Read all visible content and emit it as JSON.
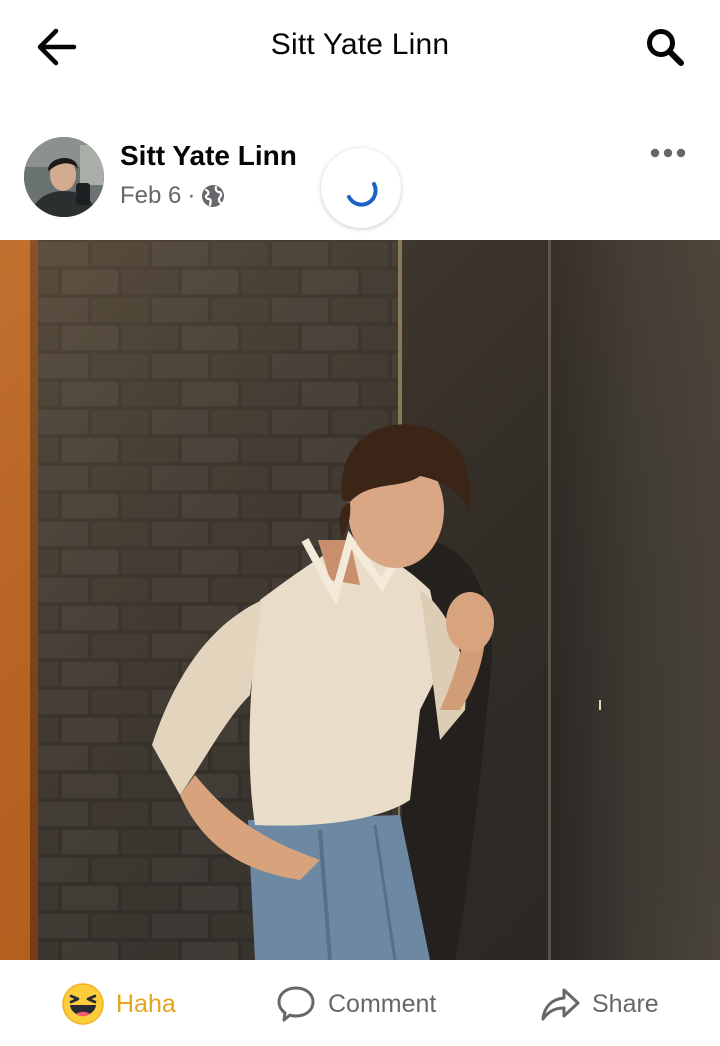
{
  "header": {
    "title": "Sitt Yate Linn",
    "back_icon": "arrow-left-icon",
    "search_icon": "search-icon"
  },
  "post": {
    "author": "Sitt Yate Linn",
    "date": "Feb 6",
    "separator": "·",
    "audience_icon": "globe-icon",
    "more_icon": "more-horizontal-icon",
    "loading_icon": "spinner-icon",
    "photo_icon": "post-photo"
  },
  "actions": {
    "reaction_label": "Haha",
    "reaction_icon": "haha-emoji-icon",
    "comment_label": "Comment",
    "comment_icon": "speech-bubble-icon",
    "share_label": "Share",
    "share_icon": "share-arrow-icon"
  },
  "colors": {
    "reaction_accent": "#e6a418",
    "secondary_text": "#65676b",
    "spinner": "#1b63c6"
  }
}
